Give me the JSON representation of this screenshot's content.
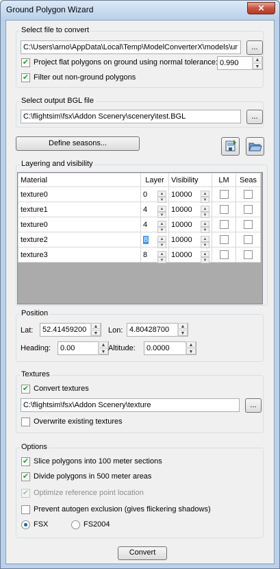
{
  "window": {
    "title": "Ground Polygon Wizard",
    "close_glyph": "✕"
  },
  "source": {
    "group_title": "Select file to convert",
    "path": "C:\\Users\\arno\\AppData\\Local\\Temp\\ModelConverterX\\models\\ur",
    "browse_label": "...",
    "project_flat_label": "Project flat polygons on ground using normal tolerance:",
    "project_flat_checked": true,
    "tolerance": "0.990",
    "filter_label": "Filter out non-ground polygons",
    "filter_checked": true
  },
  "output": {
    "group_title": "Select output BGL file",
    "path": "C:\\flightsim\\fsx\\Addon Scenery\\scenery\\test.BGL",
    "browse_label": "..."
  },
  "seasons_button": "Define seasons...",
  "layering": {
    "group_title": "Layering and visibility",
    "columns": [
      "Material",
      "Layer",
      "Visibility",
      "LM",
      "Seas"
    ],
    "rows": [
      {
        "material": "texture0",
        "layer": "0",
        "visibility": "10000"
      },
      {
        "material": "texture1",
        "layer": "4",
        "visibility": "10000"
      },
      {
        "material": "texture0",
        "layer": "4",
        "visibility": "10000"
      },
      {
        "material": "texture2",
        "layer": "8",
        "visibility": "10000"
      },
      {
        "material": "texture3",
        "layer": "8",
        "visibility": "10000"
      }
    ]
  },
  "position": {
    "group_title": "Position",
    "lat_label": "Lat:",
    "lat": "52.41459200",
    "lon_label": "Lon:",
    "lon": "4.80428700",
    "heading_label": "Heading:",
    "heading": "0.00",
    "altitude_label": "Altitude:",
    "altitude": "0.0000"
  },
  "textures": {
    "group_title": "Textures",
    "convert_label": "Convert textures",
    "convert_checked": true,
    "path": "C:\\flightsim\\fsx\\Addon Scenery\\texture",
    "browse_label": "...",
    "overwrite_label": "Overwrite existing textures",
    "overwrite_checked": false
  },
  "options": {
    "group_title": "Options",
    "slice_label": "Slice polygons into 100 meter sections",
    "divide_label": "Divide polygons in 500 meter areas",
    "optimize_label": "Optimize reference point location",
    "prevent_label": "Prevent autogen exclusion (gives flickering shadows)",
    "fsx_label": "FSX",
    "fs2004_label": "FS2004",
    "selected": "FSX"
  },
  "convert_button": "Convert",
  "colors": {
    "title_bg": "#b9d1ea",
    "close_red": "#c7543d",
    "selection_blue": "#3399ff"
  }
}
